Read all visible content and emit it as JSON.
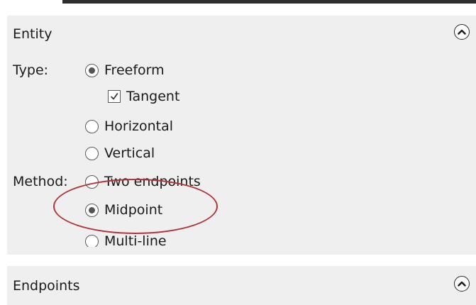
{
  "entity": {
    "title": "Entity",
    "type_label": "Type:",
    "method_label": "Method:",
    "type_options": [
      {
        "label": "Freeform",
        "selected": true
      },
      {
        "label": "Horizontal",
        "selected": false
      },
      {
        "label": "Vertical",
        "selected": false
      }
    ],
    "tangent": {
      "label": "Tangent",
      "checked": true
    },
    "method_options": [
      {
        "label": "Two endpoints",
        "selected": false
      },
      {
        "label": "Midpoint",
        "selected": true
      },
      {
        "label": "Multi-line",
        "selected": false
      }
    ]
  },
  "endpoints": {
    "title": "Endpoints"
  },
  "icons": {
    "collapse": "chevron-up-icon",
    "checkmark": "checkmark-icon"
  },
  "colors": {
    "panel_bg": "#efefef",
    "highlight_ellipse": "#b1343c",
    "top_bar": "#2e2e2e"
  }
}
